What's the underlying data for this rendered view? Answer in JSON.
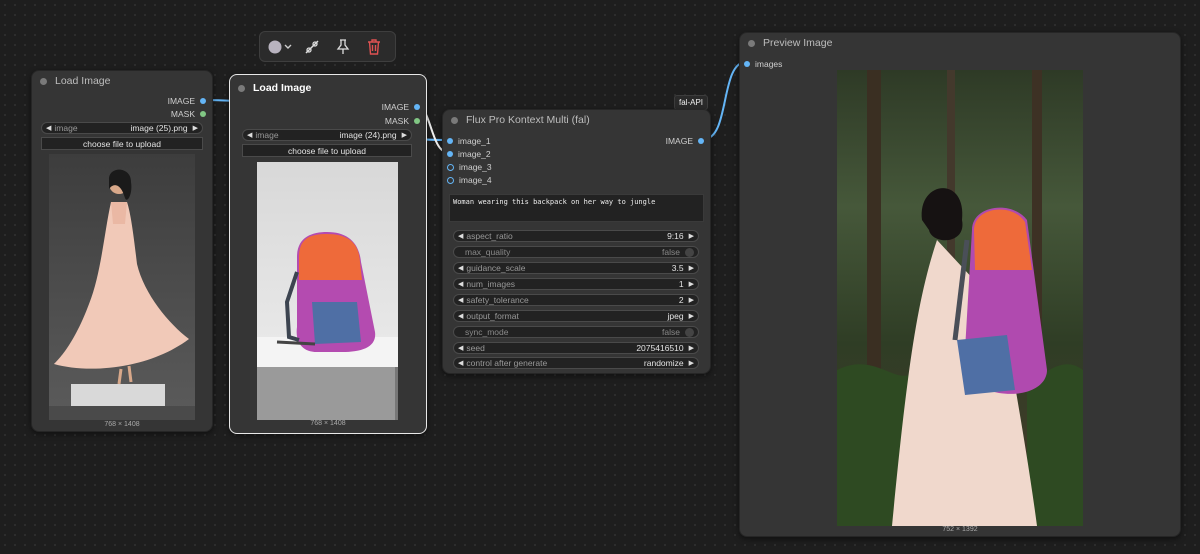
{
  "toolbar": {
    "color_icon": "color-circle-icon",
    "bypass_icon": "bypass-icon",
    "pin_icon": "pin-icon",
    "delete_icon": "trash-icon",
    "delete_color": "#e05252"
  },
  "node1": {
    "title": "Load Image",
    "outputs": [
      "IMAGE",
      "MASK"
    ],
    "image_widget": {
      "label": "image",
      "value": "image (25).png"
    },
    "upload_label": "choose file to upload",
    "dims": "768 × 1408"
  },
  "node2": {
    "title": "Load Image",
    "outputs": [
      "IMAGE",
      "MASK"
    ],
    "image_widget": {
      "label": "image",
      "value": "image (24).png"
    },
    "upload_label": "choose file to upload",
    "dims": "768 × 1408"
  },
  "flux": {
    "badge": "fal-API",
    "title": "Flux Pro Kontext Multi (fal)",
    "inputs": [
      "image_1",
      "image_2",
      "image_3",
      "image_4"
    ],
    "output": "IMAGE",
    "prompt": "Woman wearing this backpack on her way to jungle",
    "widgets": [
      {
        "label": "aspect_ratio",
        "value": "9:16",
        "type": "combo"
      },
      {
        "label": "max_quality",
        "value": "false",
        "type": "toggle"
      },
      {
        "label": "guidance_scale",
        "value": "3.5",
        "type": "number"
      },
      {
        "label": "num_images",
        "value": "1",
        "type": "number"
      },
      {
        "label": "safety_tolerance",
        "value": "2",
        "type": "number"
      },
      {
        "label": "output_format",
        "value": "jpeg",
        "type": "combo"
      },
      {
        "label": "sync_mode",
        "value": "false",
        "type": "toggle"
      },
      {
        "label": "seed",
        "value": "2075416510",
        "type": "number"
      },
      {
        "label": "control after generate",
        "value": "randomize",
        "type": "combo"
      }
    ]
  },
  "preview": {
    "title": "Preview Image",
    "input": "images",
    "dims": "752 × 1392"
  },
  "colors": {
    "canvas": "#1e1e1e",
    "node": "#353535",
    "image_link": "#64b5f6",
    "mask_socket": "#81c784"
  }
}
